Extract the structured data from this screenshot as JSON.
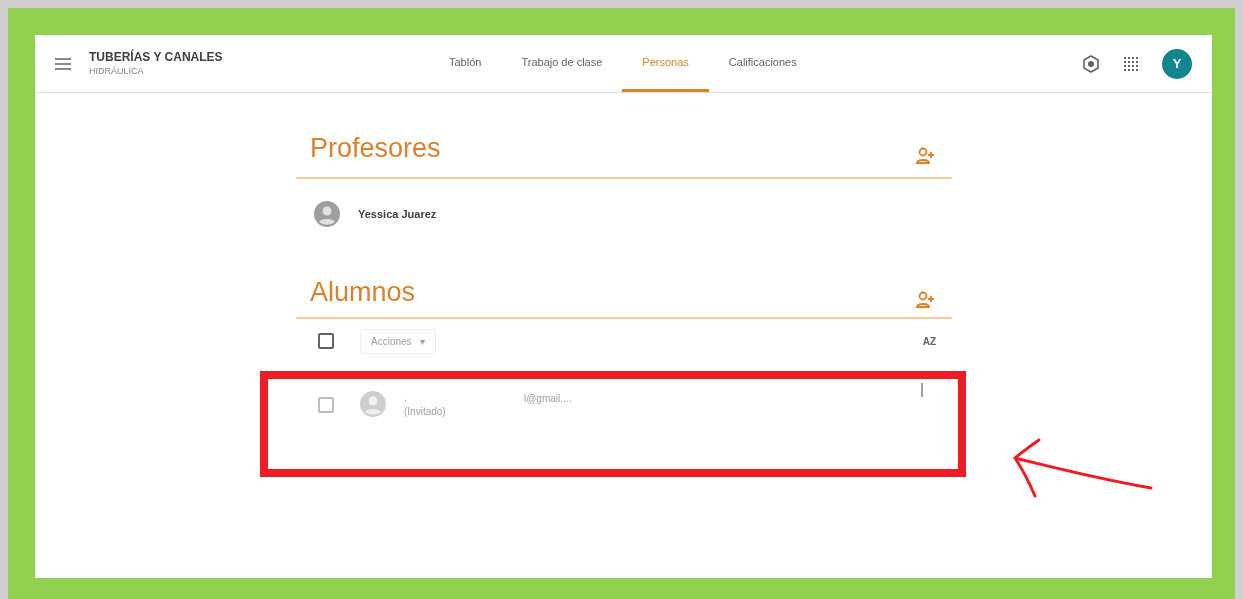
{
  "course": {
    "title": "TUBERÍAS Y CANALES",
    "subtitle": "HIDRÁULICA"
  },
  "tabs": [
    {
      "label": "Tablón",
      "selected": false
    },
    {
      "label": "Trabajo de clase",
      "selected": false
    },
    {
      "label": "Personas",
      "selected": true
    },
    {
      "label": "Calificaciones",
      "selected": false
    }
  ],
  "account": {
    "initial": "Y"
  },
  "teachers": {
    "heading": "Profesores",
    "people": [
      {
        "name": "Yessica Juarez"
      }
    ]
  },
  "students": {
    "heading": "Alumnos",
    "select_all": {
      "checked": false
    },
    "actions": "Acciones",
    "actions_caret": "▾",
    "sort": "AZ",
    "people": [
      {
        "name": ".",
        "status": "(Invitado)",
        "email": "l@gmail....",
        "checked": false,
        "highlighted": true
      }
    ]
  }
}
